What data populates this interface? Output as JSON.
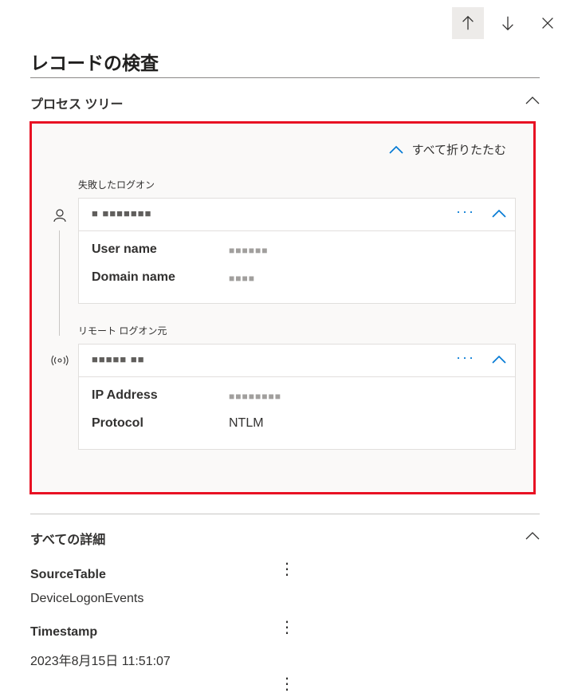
{
  "header": {
    "title": "レコードの検査"
  },
  "process_tree": {
    "section_title": "プロセス ツリー",
    "collapse_all_label": "すべて折りたたむ",
    "nodes": [
      {
        "group_label": "失敗したログオン",
        "icon": "person-icon",
        "title": "■ ■■■■■■■",
        "more_label": "···",
        "fields": [
          {
            "key": "User name",
            "value": "■■■■■■"
          },
          {
            "key": "Domain name",
            "value": "■■■■"
          }
        ]
      },
      {
        "group_label": "リモート ログオン元",
        "icon": "broadcast-icon",
        "title": "■■■■■ ■■",
        "more_label": "···",
        "fields": [
          {
            "key": "IP Address",
            "value": "■■■■■■■■"
          },
          {
            "key": "Protocol",
            "value": "NTLM"
          }
        ]
      }
    ]
  },
  "all_details": {
    "section_title": "すべての詳細",
    "items": [
      {
        "key": "SourceTable",
        "value": "DeviceLogonEvents"
      },
      {
        "key": "Timestamp",
        "value": "2023年8月15日 11:51:07"
      }
    ]
  },
  "colors": {
    "accent": "#0078d4",
    "highlight_border": "#e81123"
  }
}
